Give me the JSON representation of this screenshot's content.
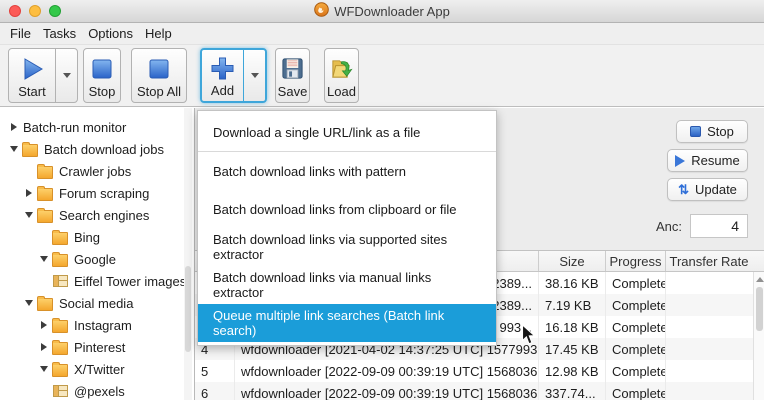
{
  "window": {
    "title": "WFDownloader App"
  },
  "menubar": {
    "items": [
      "File",
      "Tasks",
      "Options",
      "Help"
    ]
  },
  "toolbar": {
    "start_label": "Start",
    "stop_label": "Stop",
    "stop_all_label": "Stop All",
    "add_label": "Add",
    "save_label": "Save",
    "load_label": "Load"
  },
  "add_menu": {
    "items": [
      "Download a single URL/link as a file",
      "Batch download links with pattern",
      "Batch download links from clipboard or file",
      "Batch download links via supported sites extractor",
      "Batch download links via manual links extractor",
      "Queue multiple link searches (Batch link search)"
    ],
    "highlighted_index": 5
  },
  "sidebar": {
    "items": [
      {
        "label": "Batch-run monitor"
      },
      {
        "label": "Batch download jobs"
      },
      {
        "label": "Crawler jobs"
      },
      {
        "label": "Forum scraping"
      },
      {
        "label": "Search engines"
      },
      {
        "label": "Bing"
      },
      {
        "label": "Google"
      },
      {
        "label": "Eiffel Tower images"
      },
      {
        "label": "Social media"
      },
      {
        "label": "Instagram"
      },
      {
        "label": "Pinterest"
      },
      {
        "label": "X/Twitter"
      },
      {
        "label": "@pexels"
      }
    ]
  },
  "controls": {
    "stop_label": "Stop",
    "resume_label": "Resume",
    "update_label": "Update",
    "anc_label": "Anc:",
    "anc_value": "4"
  },
  "table": {
    "headers": [
      "",
      "",
      "Size",
      "Progress",
      "Transfer Rate"
    ],
    "rows": [
      {
        "num": "",
        "name": "2389...",
        "size": "38.16 KB",
        "progress": "Complete",
        "rate": ""
      },
      {
        "num": "",
        "name": "2389...",
        "size": "7.19 KB",
        "progress": "Complete",
        "rate": ""
      },
      {
        "num": "",
        "name": "993...",
        "size": "16.18 KB",
        "progress": "Complete",
        "rate": ""
      },
      {
        "num": "4",
        "name": "wfdownloader [2021-04-02 14:37:25 UTC] 1577993...",
        "size": "17.45 KB",
        "progress": "Complete",
        "rate": ""
      },
      {
        "num": "5",
        "name": "wfdownloader [2022-09-09 00:39:19 UTC] 1568036...",
        "size": "12.98 KB",
        "progress": "Complete",
        "rate": ""
      },
      {
        "num": "6",
        "name": "wfdownloader [2022-09-09 00:39:19 UTC] 1568036...",
        "size": "337.74...",
        "progress": "Complete",
        "rate": ""
      }
    ]
  },
  "icons": {
    "update_glyph": "⇅",
    "play_icon": "blue-triangle",
    "stop_icon": "blue-square",
    "add_icon": "blue-plus",
    "save_icon": "floppy-disk",
    "load_icon": "folder-green-arrow",
    "app_icon": "orange-flame-badge"
  },
  "colors": {
    "menu_highlight": "#1b9dd9",
    "add_button_outline": "#3ea6da",
    "folder": "#f4a72e",
    "traffic_red": "#fc5b57",
    "traffic_yellow": "#fdbe41",
    "traffic_green": "#34c84a"
  }
}
